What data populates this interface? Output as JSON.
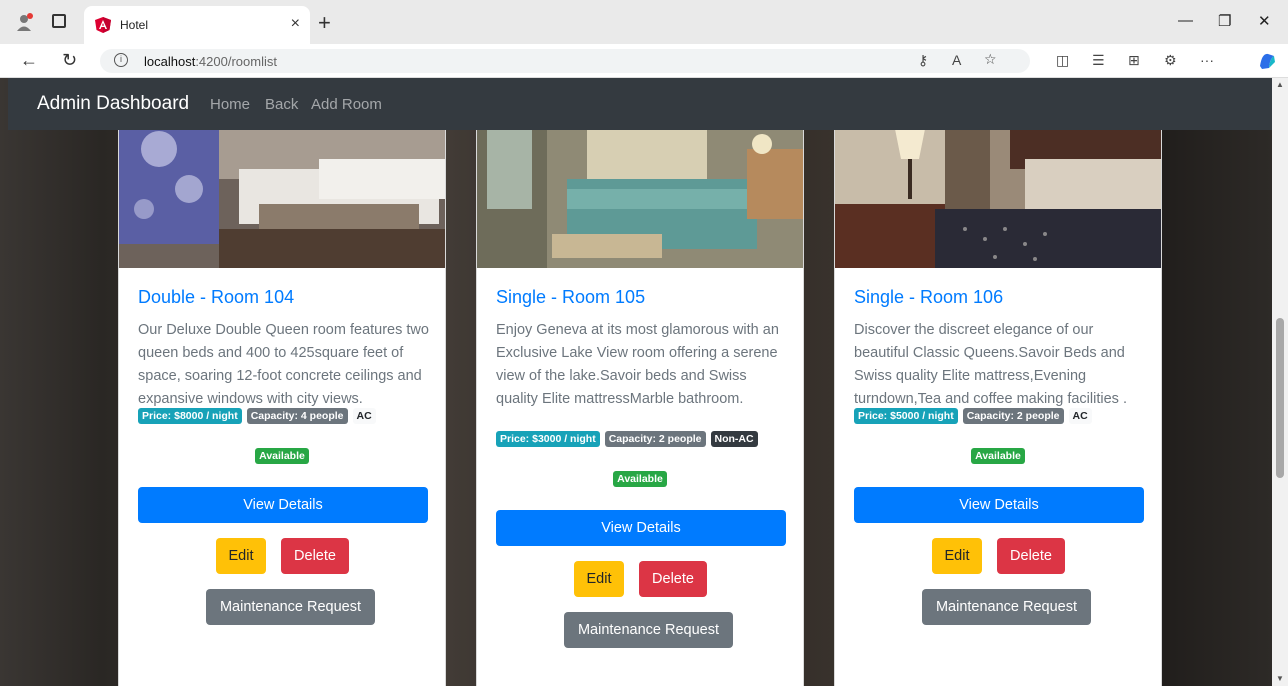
{
  "browser": {
    "tab_title": "Hotel",
    "url_host": "localhost",
    "url_path": ":4200/roomlist"
  },
  "nav": {
    "brand": "Admin Dashboard",
    "links": [
      "Home",
      "Back",
      "Add Room"
    ]
  },
  "rooms": [
    {
      "title": "Double - Room 104",
      "description": "Our Deluxe Double Queen room features two queen beds and 400 to 425square feet of space, soaring 12-foot concrete ceilings and expansive windows with city views.",
      "price": "Price: $8000 / night",
      "capacity": "Capacity: 4 people",
      "ac": "AC",
      "status": "Available",
      "view_label": "View Details",
      "edit_label": "Edit",
      "delete_label": "Delete",
      "maintenance_label": "Maintenance Request"
    },
    {
      "title": "Single - Room 105",
      "description": "Enjoy Geneva at its most glamorous with an Exclusive Lake View room offering a serene view of the lake.Savoir beds and Swiss quality Elite mattressMarble bathroom.",
      "price": "Price: $3000 / night",
      "capacity": "Capacity: 2 people",
      "ac": "Non-AC",
      "status": "Available",
      "view_label": "View Details",
      "edit_label": "Edit",
      "delete_label": "Delete",
      "maintenance_label": "Maintenance Request"
    },
    {
      "title": "Single - Room 106",
      "description": "Discover the discreet elegance of our beautiful Classic Queens.Savoir Beds and Swiss quality Elite mattress,Evening turndown,Tea and coffee making facilities .",
      "price": "Price: $5000 / night",
      "capacity": "Capacity: 2 people",
      "ac": "AC",
      "status": "Available",
      "view_label": "View Details",
      "edit_label": "Edit",
      "delete_label": "Delete",
      "maintenance_label": "Maintenance Request"
    }
  ],
  "colors": {
    "primary": "#007bff",
    "warning": "#ffc107",
    "danger": "#dc3545",
    "secondary": "#6c757d",
    "info": "#17a2b8",
    "success": "#28a745",
    "navbar": "#343a40"
  }
}
